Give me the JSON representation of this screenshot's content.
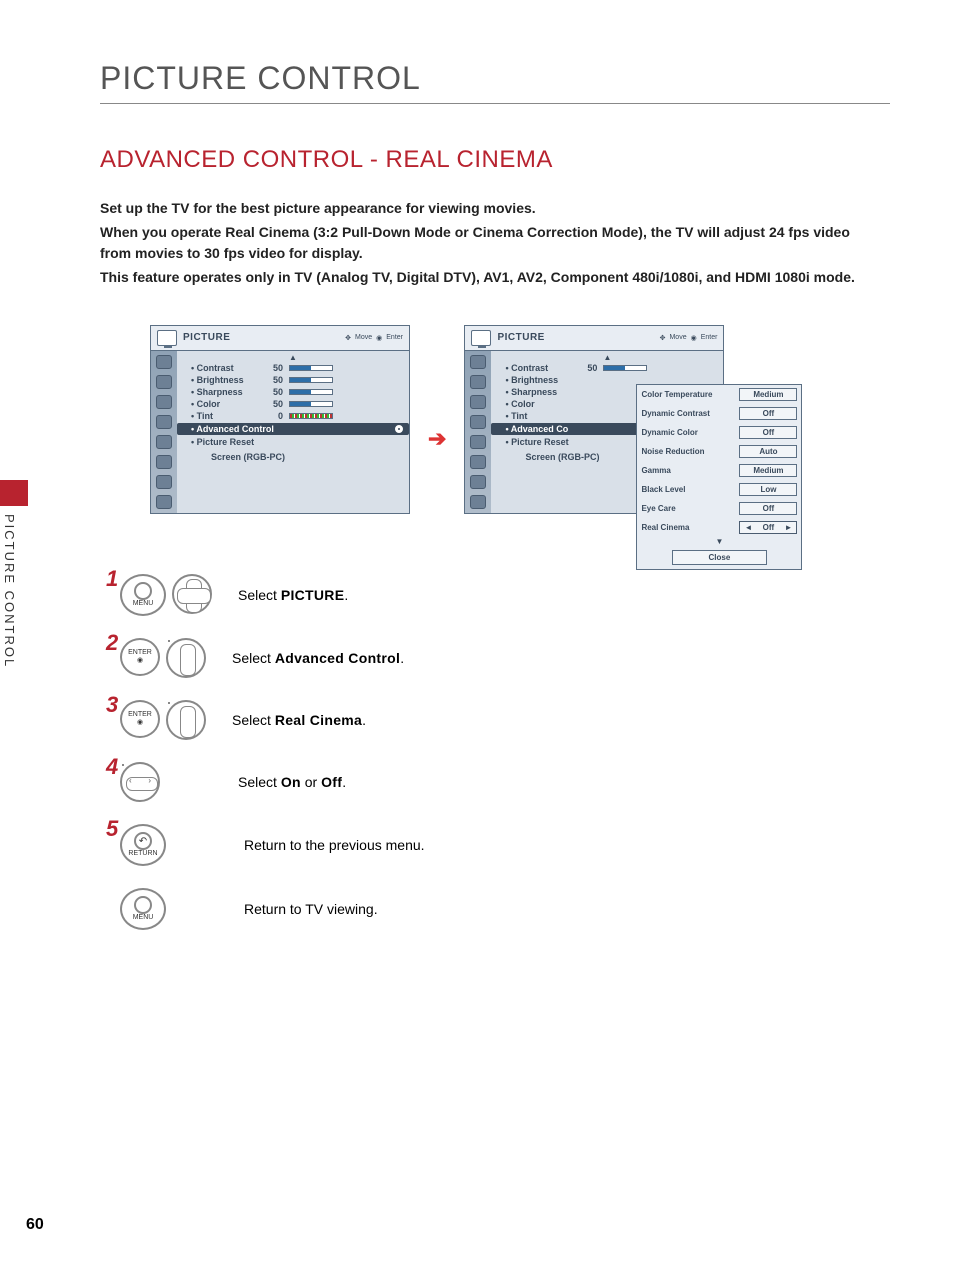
{
  "titles": {
    "main": "PICTURE CONTROL",
    "sub": "ADVANCED CONTROL - REAL CINEMA",
    "side_tab": "PICTURE CONTROL"
  },
  "body": {
    "p1": "Set up the TV for the best picture appearance for viewing movies.",
    "p2": "When you operate Real Cinema (3:2 Pull-Down Mode or Cinema Correction Mode), the TV will adjust 24 fps video from movies to 30 fps video for display.",
    "p3": "This feature operates only in TV (Analog TV, Digital DTV), AV1, AV2, Component 480i/1080i, and HDMI 1080i mode."
  },
  "osd": {
    "title": "PICTURE",
    "hint_move": "Move",
    "hint_enter": "Enter",
    "screen_label": "Screen (RGB-PC)",
    "items": {
      "contrast": "• Contrast",
      "brightness": "• Brightness",
      "sharpness": "• Sharpness",
      "color": "• Color",
      "tint": "• Tint",
      "advanced": "• Advanced Control",
      "advanced_trunc": "• Advanced Co",
      "reset": "• Picture Reset"
    },
    "values": {
      "v50": "50",
      "v0": "0"
    }
  },
  "advanced": {
    "color_temp": {
      "label": "Color Temperature",
      "value": "Medium"
    },
    "dyn_contrast": {
      "label": "Dynamic Contrast",
      "value": "Off"
    },
    "dyn_color": {
      "label": "Dynamic Color",
      "value": "Off"
    },
    "noise": {
      "label": "Noise Reduction",
      "value": "Auto"
    },
    "gamma": {
      "label": "Gamma",
      "value": "Medium"
    },
    "black": {
      "label": "Black Level",
      "value": "Low"
    },
    "eye": {
      "label": "Eye Care",
      "value": "Off"
    },
    "real": {
      "label": "Real Cinema",
      "value": "Off"
    },
    "close": "Close"
  },
  "steps": {
    "s1": {
      "pre": "Select ",
      "bold": "PICTURE",
      "post": ".",
      "btn": "MENU"
    },
    "s2": {
      "pre": "Select ",
      "bold": "Advanced Control",
      "post": ".",
      "btn": "ENTER"
    },
    "s3": {
      "pre": "Select ",
      "bold": "Real Cinema",
      "post": ".",
      "btn": "ENTER"
    },
    "s4": {
      "pre": "Select ",
      "bold": "On",
      "mid": " or ",
      "bold2": "Off",
      "post": "."
    },
    "s5": {
      "text": "Return to the previous menu.",
      "btn": "RETURN"
    },
    "s6": {
      "text": "Return to TV viewing.",
      "btn": "MENU"
    }
  },
  "page_number": "60"
}
